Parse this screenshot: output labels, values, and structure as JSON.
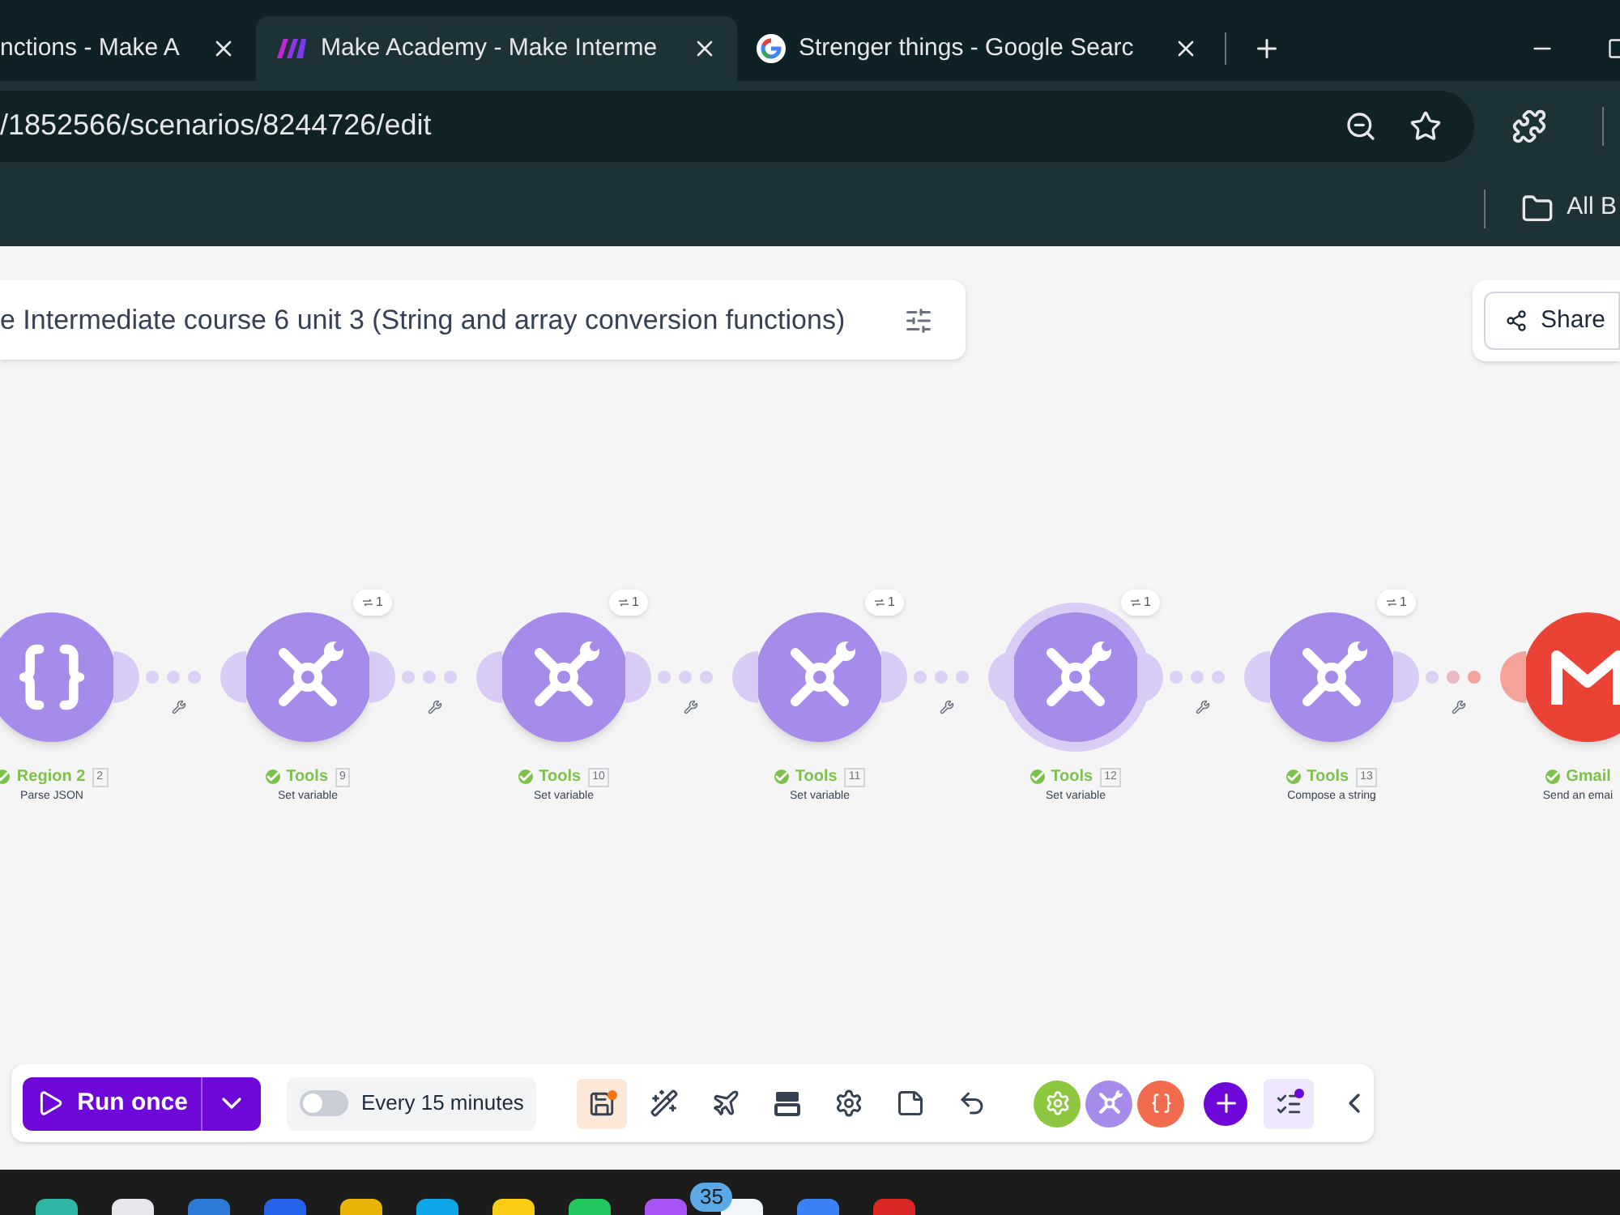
{
  "browser": {
    "tabs": [
      {
        "title": "nctions - Make A",
        "selected": false
      },
      {
        "title": "Make Academy - Make Interme",
        "selected": true,
        "kind": "make"
      },
      {
        "title": "Strenger things - Google Searc",
        "selected": false,
        "kind": "google"
      }
    ],
    "url": "/1852566/scenarios/8244726/edit",
    "bookmarks": [
      "All B"
    ]
  },
  "scenario": {
    "title": "e Intermediate course 6 unit 3 (String and array conversion functions)",
    "share_label": "Share"
  },
  "modules": [
    {
      "app": "Region 2",
      "number": "2",
      "action": "Parse JSON",
      "kind": "json",
      "selected": false
    },
    {
      "app": "Tools",
      "number": "9",
      "action": "Set variable",
      "kind": "tools",
      "badge": "1",
      "selected": false
    },
    {
      "app": "Tools",
      "number": "10",
      "action": "Set variable",
      "kind": "tools",
      "badge": "1",
      "selected": false
    },
    {
      "app": "Tools",
      "number": "11",
      "action": "Set variable",
      "kind": "tools",
      "badge": "1",
      "selected": false
    },
    {
      "app": "Tools",
      "number": "12",
      "action": "Set variable",
      "kind": "tools",
      "badge": "1",
      "selected": true
    },
    {
      "app": "Tools",
      "number": "13",
      "action": "Compose a string",
      "kind": "tools",
      "badge": "1",
      "selected": false
    },
    {
      "app": "Gmail",
      "action": "Send an emai",
      "kind": "gmail",
      "selected": false
    }
  ],
  "toolbar": {
    "run_label": "Run once",
    "schedule": {
      "on": false,
      "label": "Every 15 minutes"
    }
  },
  "taskbar": {
    "badge": "35"
  }
}
